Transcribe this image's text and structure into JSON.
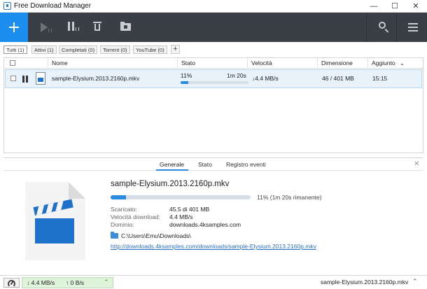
{
  "window": {
    "title": "Free Download Manager",
    "minimize": "—",
    "maximize": "☐",
    "close": "✕"
  },
  "toolbar": {
    "buttons": [
      "add-icon",
      "play-icon",
      "pause-icon",
      "trash-icon",
      "folder-icon",
      "search-icon",
      "menu-icon"
    ]
  },
  "filters": {
    "tabs": [
      {
        "label": "Tutti (1)",
        "active": true
      },
      {
        "label": "Attivi (1)",
        "active": false
      },
      {
        "label": "Completati (0)",
        "active": false
      },
      {
        "label": "Torrent (0)",
        "active": false
      },
      {
        "label": "YouTube (0)",
        "active": false
      }
    ],
    "add": "+"
  },
  "list": {
    "columns": {
      "name": "Nome",
      "state": "Stato",
      "speed": "Velocità",
      "size": "Dimensione",
      "added": "Aggiunto",
      "sort_arrow": "⌄"
    },
    "rows": [
      {
        "name": "sample-Elysium.2013.2160p.mkv",
        "percent": "11%",
        "progress": 0.11,
        "eta": "1m 20s",
        "speed": "↓4.4 MB/s",
        "size": "46 / 401 MB",
        "added": "15:15"
      }
    ]
  },
  "details": {
    "tabs": [
      "Generale",
      "Stato",
      "Registro eventi"
    ],
    "close": "✕",
    "title": "sample-Elysium.2013.2160p.mkv",
    "progress": 0.11,
    "progress_text": "11% (1m 20s rimanente)",
    "fields": [
      {
        "label": "Scaricato:",
        "value": "45.5 di 401 MB"
      },
      {
        "label": "Velocità download:",
        "value": "4.4 MB/s"
      },
      {
        "label": "Dominio:",
        "value": "downloads.4ksamples.com"
      }
    ],
    "path": "C:\\Users\\Emu\\Downloads\\",
    "url": "http://downloads.4ksamples.com/downloads/sample-Elysium.2013.2160p.mkv"
  },
  "statusbar": {
    "down": "↓ 4.4 MB/s",
    "up": "↑ 0 B/s",
    "chevron": "⌃",
    "file": "sample-Elysium.2013.2160p.mkv",
    "file_chevron": "⌃"
  },
  "colors": {
    "accent": "#1b8ef0",
    "toolbar_bg": "#3a3e45",
    "progress": "#2b8be3",
    "selected_row": "#e7f2fb",
    "speed_bg": "#dff3da"
  }
}
